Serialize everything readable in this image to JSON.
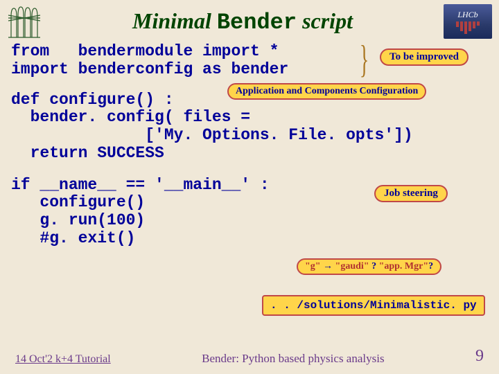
{
  "title_parts": {
    "pre": "Minimal ",
    "mono": "Bender",
    "post": " script"
  },
  "logo_right_text": "LHCb",
  "code": {
    "imports": "from   bendermodule import *\nimport benderconfig as bender",
    "configure": "def configure() :\n  bender. config( files =\n              ['My. Options. File. opts'])\n  return SUCCESS",
    "main": "if __name__ == '__main__' :\n   configure()\n   g. run(100)\n   #g. exit()"
  },
  "tags": {
    "improved": "To be improved",
    "appcfg": "Application and Components Configuration",
    "jobsteer": "Job steering",
    "g_parts": {
      "a": "\"g\"",
      "arrow": " → ",
      "b": "\"gaudi\"",
      "q": " ? ",
      "c": "\"app. Mgr\"",
      "d": "?"
    },
    "path": ". . /solutions/Minimalistic. py"
  },
  "footer": {
    "left": "14 Oct'2 k+4 Tutorial",
    "center": "Bender: Python based physics analysis",
    "right": "9"
  }
}
